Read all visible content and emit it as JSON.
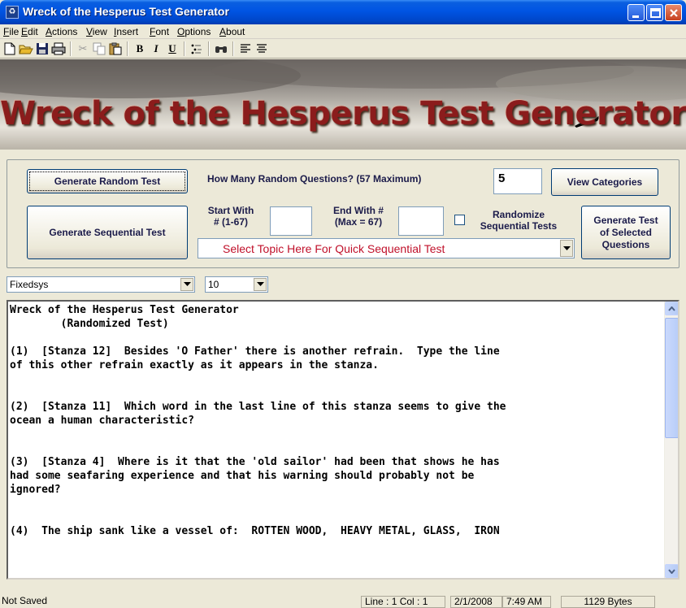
{
  "window": {
    "title": "Wreck of the Hesperus Test Generator"
  },
  "menu": [
    "File",
    "Edit",
    "Actions",
    "View",
    "Insert",
    "Font",
    "Options",
    "About"
  ],
  "toolbar": {
    "icons": [
      "new-file-icon",
      "open-folder-icon",
      "save-icon",
      "print-icon",
      "cut-icon",
      "copy-icon",
      "paste-icon",
      "bold-icon",
      "italic-icon",
      "underline-icon",
      "bullets-icon",
      "find-icon",
      "align-left-icon",
      "align-center-icon"
    ],
    "bold": "B",
    "italic": "I",
    "underline": "U"
  },
  "banner": {
    "text": "Wreck of the Hesperus Test Generator"
  },
  "controls": {
    "generate_random": "Generate Random Test",
    "how_many_label": "How Many Random Questions? (57 Maximum)",
    "how_many_value": "5",
    "view_categories": "View Categories",
    "generate_sequential": "Generate Sequential Test",
    "start_with_label": "Start With\n# (1-67)",
    "start_with_value": "",
    "end_with_label": "End With #\n(Max = 67)",
    "end_with_value": "",
    "randomize_label": "Randomize\nSequential Tests",
    "randomize_checked": false,
    "generate_selected": "Generate Test\nof Selected\nQuestions",
    "topic_select": "Select Topic Here For Quick Sequential Test"
  },
  "fontbar": {
    "font": "Fixedsys",
    "size": "10"
  },
  "editor": {
    "content": "Wreck of the Hesperus Test Generator\n        (Randomized Test)\n\n(1)  [Stanza 12]  Besides 'O Father' there is another refrain.  Type the line\nof this other refrain exactly as it appears in the stanza.\n\n\n(2)  [Stanza 11]  Which word in the last line of this stanza seems to give the\nocean a human characteristic?\n\n\n(3)  [Stanza 4]  Where is it that the 'old sailor' had been that shows he has\nhad some seafaring experience and that his warning should probably not be\nignored?\n\n\n(4)  The ship sank like a vessel of:  ROTTEN WOOD,  HEAVY METAL, GLASS,  IRON"
  },
  "status": {
    "saved": "Not Saved",
    "position": "Line : 1  Col : 1",
    "date": "2/1/2008",
    "time": "7:49 AM",
    "size": "1129 Bytes"
  },
  "colors": {
    "titlebar": "#0054e3",
    "banner_text": "#8b1c1c",
    "topic_text": "#c0102a"
  }
}
